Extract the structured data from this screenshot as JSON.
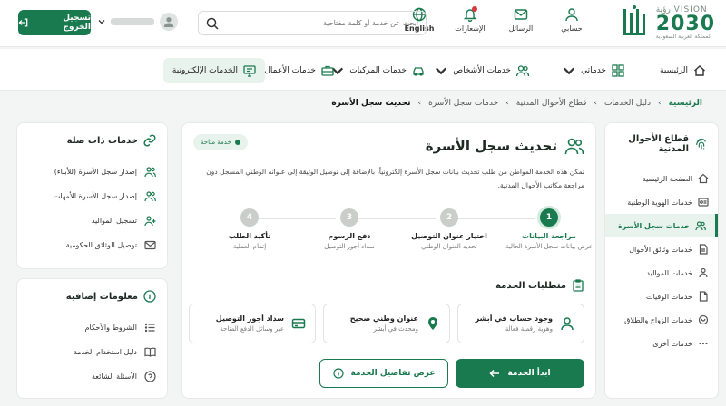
{
  "header": {
    "logo_vision": "VISION رؤية",
    "logo_year": "2030",
    "logo_text": "المملكة العربية السعودية",
    "nav": [
      {
        "label": "حسابي",
        "icon": "person-icon"
      },
      {
        "label": "الرسائل",
        "icon": "mail-icon"
      },
      {
        "label": "الإشعارات",
        "icon": "bell-icon"
      },
      {
        "label": "English",
        "icon": "globe-icon"
      }
    ],
    "search_placeholder": "ابحث عن خدمة أو كلمة مفتاحية",
    "logout_label": "تسجيل الخروج"
  },
  "main_nav": [
    {
      "label": "الرئيسية",
      "icon": "home-icon"
    },
    {
      "label": "خدماتي",
      "icon": "grid-icon"
    },
    {
      "label": "خدمات الأشخاص",
      "icon": "people-icon"
    },
    {
      "label": "خدمات المركبات",
      "icon": "car-icon"
    },
    {
      "label": "خدمات الأعمال",
      "icon": "briefcase-icon"
    },
    {
      "label": "الخدمات الإلكترونية",
      "icon": "monitor-icon"
    }
  ],
  "breadcrumb": [
    "الرئيسية",
    "دليل الخدمات",
    "قطاع الأحوال المدنية",
    "خدمات سجل الأسرة",
    "تحديث سجل الأسرة"
  ],
  "sidebar": {
    "title": "قطاع الأحوال المدنية",
    "items": [
      {
        "label": "الصفحة الرئيسية"
      },
      {
        "label": "خدمات الهوية الوطنية"
      },
      {
        "label": "خدمات سجل الأسرة"
      },
      {
        "label": "خدمات وثائق الأحوال"
      },
      {
        "label": "خدمات المواليد"
      },
      {
        "label": "خدمات الوفيات"
      },
      {
        "label": "خدمات الزواج والطلاق"
      },
      {
        "label": "خدمات أخرى"
      }
    ]
  },
  "service": {
    "badge": "خدمة متاحة",
    "title": "تحديث سجل الأسرة",
    "description": "تمكن هذه الخدمة المواطن من طلب تحديث بيانات سجل الأسرة إلكترونياً، بالإضافة إلى توصيل الوثيقة إلى عنوانه الوطني المسجل دون مراجعة مكاتب الأحوال المدنية.",
    "steps": [
      {
        "num": "1",
        "label": "مراجعة البيانات",
        "sub": "عرض بيانات سجل الأسرة الحالية"
      },
      {
        "num": "2",
        "label": "اختيار عنوان التوصيل",
        "sub": "تحديد العنوان الوطني"
      },
      {
        "num": "3",
        "label": "دفع الرسوم",
        "sub": "سداد أجور التوصيل"
      },
      {
        "num": "4",
        "label": "تأكيد الطلب",
        "sub": "إتمام العملية"
      }
    ],
    "requirements_title": "متطلبات الخدمة",
    "requirements": [
      {
        "title": "وجود حساب في أبشر",
        "sub": "وهوية رقمية فعالة"
      },
      {
        "title": "عنوان وطني صحيح",
        "sub": "ومحدث في أبشر"
      },
      {
        "title": "سداد أجور التوصيل",
        "sub": "عبر وسائل الدفع المتاحة"
      }
    ],
    "start_label": "ابدأ الخدمة",
    "details_label": "عرض تفاصيل الخدمة"
  },
  "related": {
    "title": "خدمات ذات صلة",
    "items": [
      {
        "label": "إصدار سجل الأسرة (للأبناء)"
      },
      {
        "label": "إصدار سجل الأسرة للأمهات"
      },
      {
        "label": "تسجيل المواليد"
      },
      {
        "label": "توصيل الوثائق الحكومية"
      }
    ]
  },
  "more_info": {
    "title": "معلومات إضافية",
    "items": [
      {
        "label": "الشروط والأحكام"
      },
      {
        "label": "دليل استخدام الخدمة"
      },
      {
        "label": "الأسئلة الشائعة"
      }
    ]
  },
  "colors": {
    "primary": "#1a7a4f",
    "accent_light": "#e9f3ee",
    "alert": "#d9363e"
  }
}
